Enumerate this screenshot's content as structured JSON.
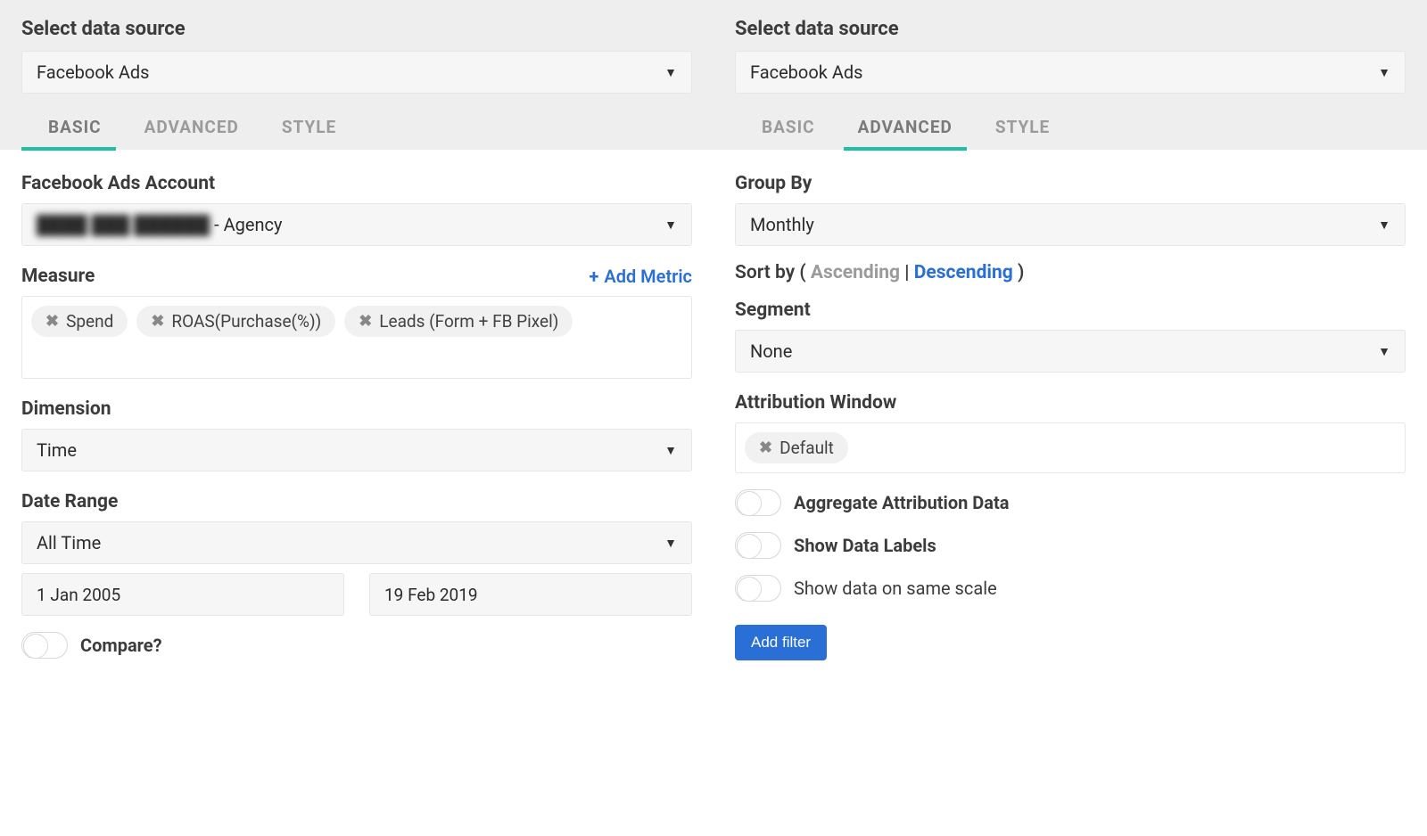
{
  "left": {
    "header": {
      "title": "Select data source",
      "source": "Facebook Ads"
    },
    "tabs": [
      "BASIC",
      "ADVANCED",
      "STYLE"
    ],
    "active_tab": 0,
    "account": {
      "label": "Facebook Ads Account",
      "value_masked": "████ ███ ██████",
      "value_suffix": " - Agency"
    },
    "measure": {
      "label": "Measure",
      "add_label": "Add Metric",
      "chips": [
        "Spend",
        "ROAS(Purchase(%))",
        "Leads (Form + FB Pixel)"
      ]
    },
    "dimension": {
      "label": "Dimension",
      "value": "Time"
    },
    "date_range": {
      "label": "Date Range",
      "value": "All Time",
      "start": "1 Jan 2005",
      "end": "19 Feb 2019"
    },
    "compare": {
      "label": "Compare?",
      "on": false
    }
  },
  "right": {
    "header": {
      "title": "Select data source",
      "source": "Facebook Ads"
    },
    "tabs": [
      "BASIC",
      "ADVANCED",
      "STYLE"
    ],
    "active_tab": 1,
    "group_by": {
      "label": "Group By",
      "value": "Monthly"
    },
    "sort": {
      "prefix": "Sort by ( ",
      "asc": "Ascending",
      "sep": "  |  ",
      "desc": "Descending",
      "suffix": " )"
    },
    "segment": {
      "label": "Segment",
      "value": "None"
    },
    "attribution": {
      "label": "Attribution Window",
      "chips": [
        "Default"
      ]
    },
    "toggles": {
      "aggregate": {
        "label": "Aggregate Attribution Data",
        "on": false
      },
      "labels": {
        "label": "Show Data Labels",
        "on": false
      },
      "samescale": {
        "label": "Show data on same scale",
        "on": false
      }
    },
    "add_filter": "Add filter"
  }
}
